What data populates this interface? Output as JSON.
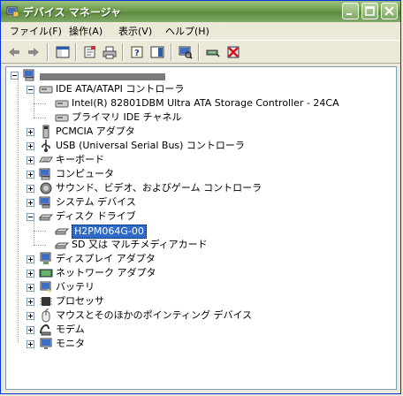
{
  "window": {
    "title": "デバイス マネージャ"
  },
  "menu": [
    {
      "label": "ファイル(F)"
    },
    {
      "label": "操作(A)"
    },
    {
      "label": "表示(V)"
    },
    {
      "label": "ヘルプ(H)"
    }
  ],
  "toolbar": [
    "back-arrow-icon",
    "forward-arrow-icon",
    "console-tree-icon",
    "properties-icon",
    "print-icon",
    "help-icon",
    "view-icon",
    "scan-hardware-icon",
    "disable-device-icon",
    "uninstall-device-icon"
  ],
  "tree": {
    "root": "",
    "ide_group": "IDE ATA/ATAPI コントローラ",
    "ide_children": [
      "Intel(R) 82801DBM Ultra ATA Storage Controller - 24CA",
      "プライマリ IDE チャネル"
    ],
    "pcmcia": "PCMCIA アダプタ",
    "usb": "USB (Universal Serial Bus) コントローラ",
    "keyboard": "キーボード",
    "computer": "コンピュータ",
    "sound": "サウンド、ビデオ、およびゲーム コントローラ",
    "system": "システム デバイス",
    "disk_group": "ディスク ドライブ",
    "disk_children": [
      "H2PM064G-00",
      "SD  又は  マルチメディアカード"
    ],
    "display": "ディスプレイ アダプタ",
    "network": "ネットワーク アダプタ",
    "battery": "バッテリ",
    "processor": "プロセッサ",
    "mouse": "マウスとそのほかのポインティング デバイス",
    "modem": "モデム",
    "monitor": "モニタ"
  }
}
